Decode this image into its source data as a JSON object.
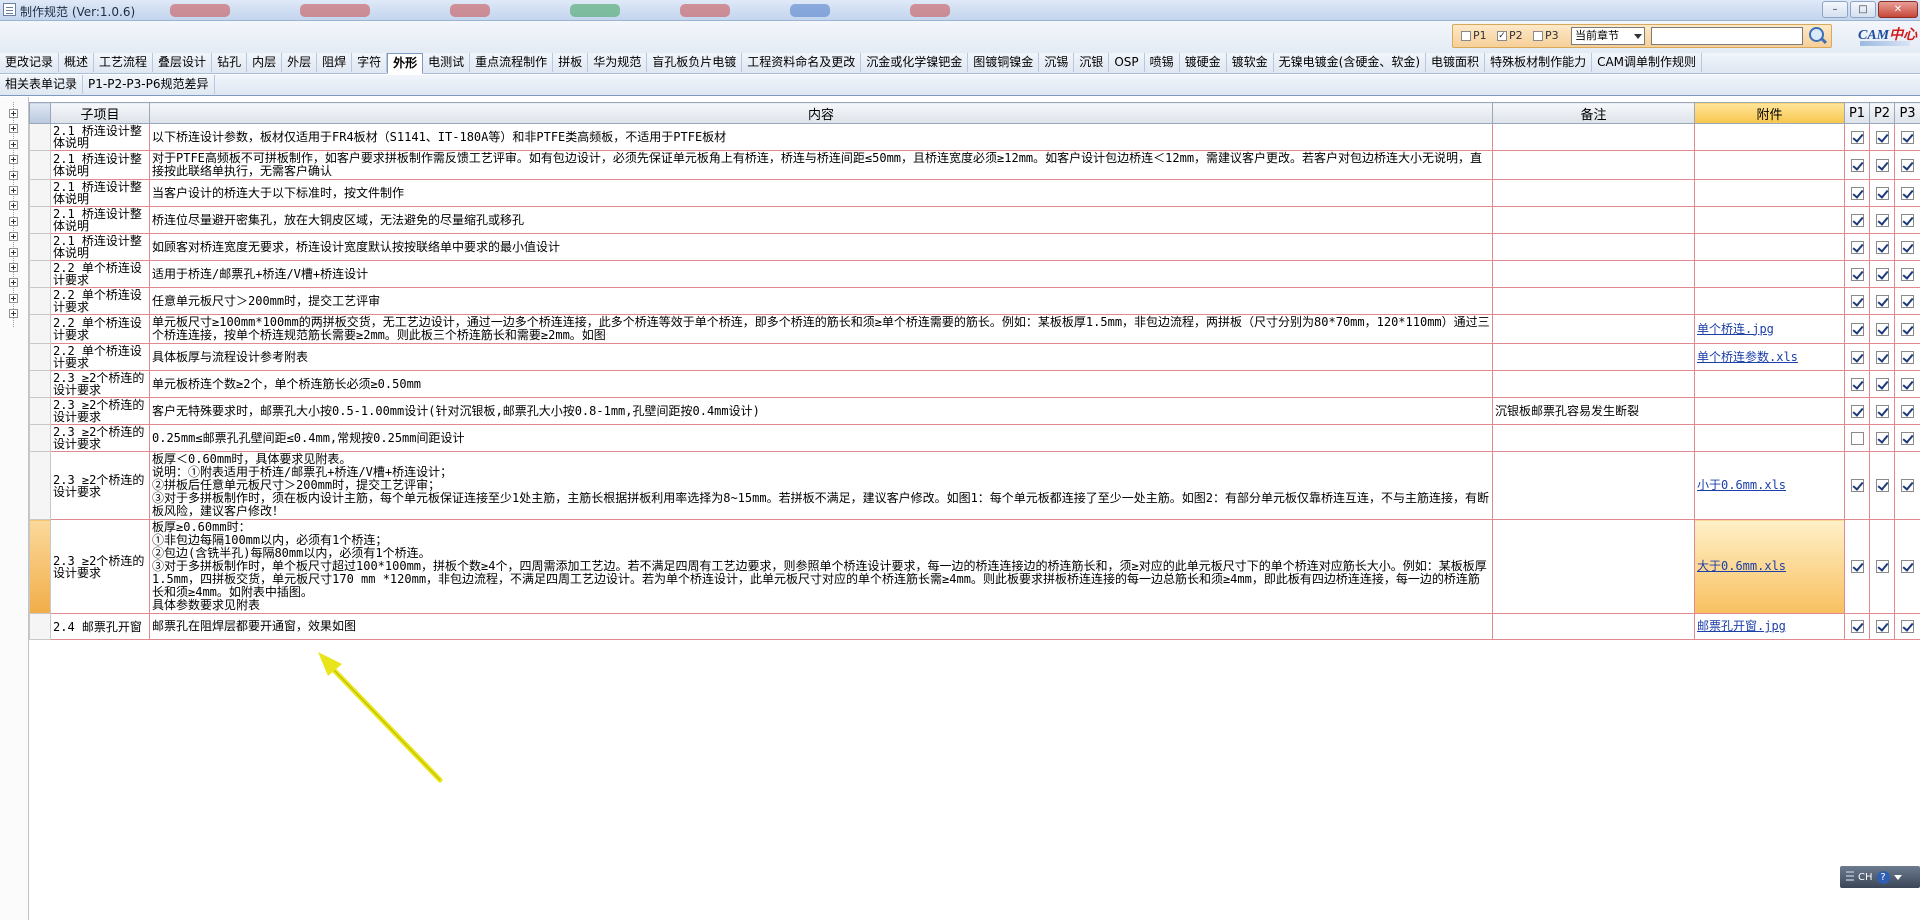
{
  "window": {
    "title": "制作规范 (Ver:1.0.6)"
  },
  "filter": {
    "p1_label": "P1",
    "p2_label": "P2",
    "p3_label": "P3",
    "p1_checked": false,
    "p2_checked": true,
    "p3_checked": false,
    "scope_value": "当前章节",
    "search_value": ""
  },
  "logo": {
    "text_a": "CAM",
    "text_b": "中心"
  },
  "tabs_row1": [
    "更改记录",
    "概述",
    "工艺流程",
    "叠层设计",
    "钻孔",
    "内层",
    "外层",
    "阻焊",
    "字符",
    "外形",
    "电测试",
    "重点流程制作",
    "拼板",
    "华为规范",
    "盲孔板负片电镀",
    "工程资料命名及更改",
    "沉金或化学镍钯金",
    "图镀铜镍金",
    "沉锡",
    "沉银",
    "OSP",
    "喷锡",
    "镀硬金",
    "镀软金",
    "无镍电镀金(含硬金、软金)",
    "电镀面积",
    "特殊板材制作能力",
    "CAM调单制作规则"
  ],
  "active_tab": "外形",
  "tabs_row2": [
    "相关表单记录",
    "P1-P2-P3-P6规范差异"
  ],
  "grid": {
    "headers": {
      "item": "子项目",
      "content": "内容",
      "remark": "备注",
      "attach": "附件",
      "p1": "P1",
      "p2": "P2",
      "p3": "P3"
    },
    "rows": [
      {
        "item": "2.1 桥连设计整体说明",
        "content": "以下桥连设计参数，板材仅适用于FR4板材（S1141、IT-180A等）和非PTFE类高频板，不适用于PTFE板材",
        "remark": "",
        "attach": "",
        "p1": true,
        "p2": true,
        "p3": true
      },
      {
        "item": "2.1 桥连设计整体说明",
        "content": "对于PTFE高频板不可拼板制作，如客户要求拼板制作需反馈工艺评审。如有包边设计，必须先保证单元板角上有桥连，桥连与桥连间距≤50mm，且桥连宽度必须≥12mm。如客户设计包边桥连＜12mm，需建议客户更改。若客户对包边桥连大小无说明，直接按此联络单执行，无需客户确认",
        "remark": "",
        "attach": "",
        "p1": true,
        "p2": true,
        "p3": true
      },
      {
        "item": "2.1 桥连设计整体说明",
        "content": "当客户设计的桥连大于以下标准时，按文件制作",
        "remark": "",
        "attach": "",
        "p1": true,
        "p2": true,
        "p3": true
      },
      {
        "item": "2.1 桥连设计整体说明",
        "content": "桥连位尽量避开密集孔，放在大铜皮区域，无法避免的尽量缩孔或移孔",
        "remark": "",
        "attach": "",
        "p1": true,
        "p2": true,
        "p3": true
      },
      {
        "item": "2.1 桥连设计整体说明",
        "content": "如顾客对桥连宽度无要求，桥连设计宽度默认按按联络单中要求的最小值设计",
        "remark": "",
        "attach": "",
        "p1": true,
        "p2": true,
        "p3": true
      },
      {
        "item": "2.2 单个桥连设计要求",
        "content": "适用于桥连/邮票孔+桥连/V槽+桥连设计",
        "remark": "",
        "attach": "",
        "p1": true,
        "p2": true,
        "p3": true
      },
      {
        "item": "2.2 单个桥连设计要求",
        "content": "任意单元板尺寸＞200mm时，提交工艺评审",
        "remark": "",
        "attach": "",
        "p1": true,
        "p2": true,
        "p3": true
      },
      {
        "item": "2.2 单个桥连设计要求",
        "content": "单元板尺寸≥100mm*100mm的两拼板交货，无工艺边设计，通过一边多个桥连连接，此多个桥连等效于单个桥连，即多个桥连的筋长和须≥单个桥连需要的筋长。例如：某板板厚1.5mm，非包边流程，两拼板（尺寸分别为80*70mm，120*110mm）通过三个桥连连接，按单个桥连规范筋长需要≥2mm。则此板三个桥连筋长和需要≥2mm。如图",
        "remark": "",
        "attach": "单个桥连.jpg",
        "p1": true,
        "p2": true,
        "p3": true
      },
      {
        "item": "2.2 单个桥连设计要求",
        "content": "具体板厚与流程设计参考附表",
        "remark": "",
        "attach": "单个桥连参数.xls",
        "p1": true,
        "p2": true,
        "p3": true
      },
      {
        "item": "2.3 ≥2个桥连的设计要求",
        "content": "单元板桥连个数≥2个，单个桥连筋长必须≥0.50mm",
        "remark": "",
        "attach": "",
        "p1": true,
        "p2": true,
        "p3": true
      },
      {
        "item": "2.3 ≥2个桥连的设计要求",
        "content": "客户无特殊要求时，邮票孔大小按0.5-1.00mm设计(针对沉银板,邮票孔大小按0.8-1mm,孔壁间距按0.4mm设计)",
        "remark": "沉银板邮票孔容易发生断裂",
        "attach": "",
        "p1": true,
        "p2": true,
        "p3": true
      },
      {
        "item": "2.3 ≥2个桥连的设计要求",
        "content": "0.25mm≤邮票孔孔壁间距≤0.4mm,常规按0.25mm间距设计",
        "remark": "",
        "attach": "",
        "p1": false,
        "p2": true,
        "p3": true
      },
      {
        "item": "2.3 ≥2个桥连的设计要求",
        "content": "板厚＜0.60mm时，具体要求见附表。\n说明：①附表适用于桥连/邮票孔+桥连/V槽+桥连设计；\n②拼板后任意单元板尺寸＞200mm时，提交工艺评审；\n③对于多拼板制作时，须在板内设计主筋，每个单元板保证连接至少1处主筋，主筋长根据拼板利用率选择为8~15mm。若拼板不满足，建议客户修改。如图1：每个单元板都连接了至少一处主筋。如图2：有部分单元板仅靠桥连互连，不与主筋连接，有断板风险，建议客户修改！",
        "remark": "",
        "attach": "小于0.6mm.xls",
        "p1": true,
        "p2": true,
        "p3": true
      },
      {
        "item": "2.3 ≥2个桥连的设计要求",
        "content": "板厚≥0.60mm时：\n①非包边每隔100mm以内，必须有1个桥连；\n②包边(含铣半孔)每隔80mm以内，必须有1个桥连。\n③对于多拼板制作时，单个板尺寸超过100*100mm，拼板个数≥4个，四周需添加工艺边。若不满足四周有工艺边要求，则参照单个桥连设计要求，每一边的桥连连接边的桥连筋长和，须≥对应的此单元板尺寸下的单个桥连对应筋长大小。例如：某板板厚1.5mm，四拼板交货，单元板尺寸170 mm *120mm，非包边流程，不满足四周工艺边设计。若为单个桥连设计，此单元板尺寸对应的单个桥连筋长需≥4mm。则此板要求拼板桥连连接的每一边总筋长和须≥4mm，即此板有四边桥连连接，每一边的桥连筋长和须≥4mm。如附表中插图。\n具体参数要求见附表",
        "remark": "",
        "attach": "大于0.6mm.xls",
        "p1": true,
        "p2": true,
        "p3": true
      },
      {
        "item": "2.4 邮票孔开窗",
        "content": "邮票孔在阻焊层都要开通窗，效果如图",
        "remark": "",
        "attach": "邮票孔开窗.jpg",
        "p1": true,
        "p2": true,
        "p3": true
      }
    ]
  },
  "tray": {
    "lang": "CH",
    "help": "?"
  }
}
